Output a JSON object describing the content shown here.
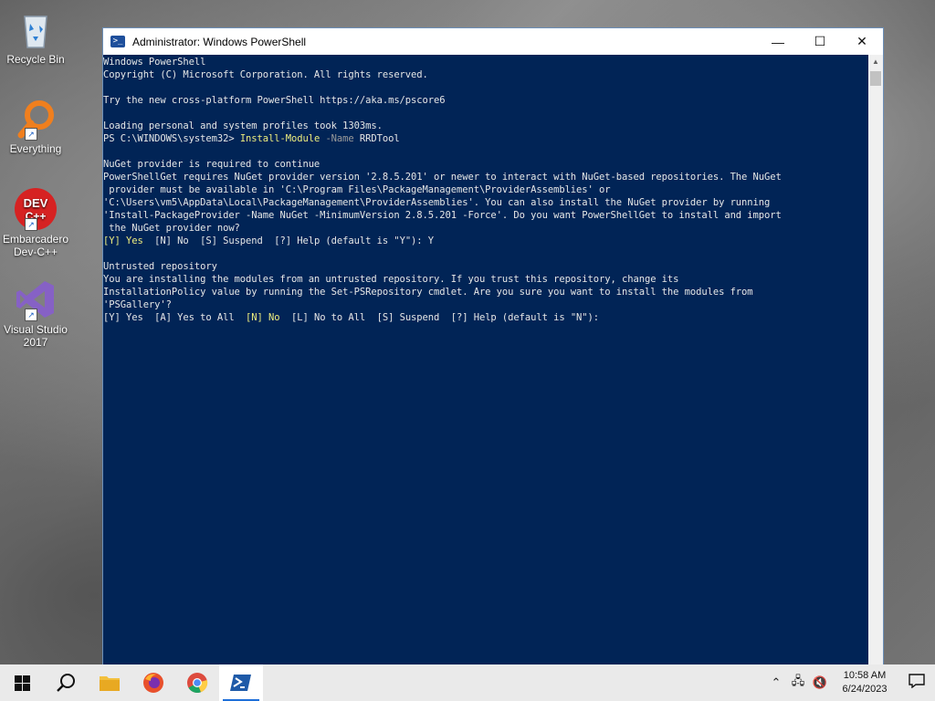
{
  "desktop": {
    "icons": [
      {
        "label": "Recycle Bin"
      },
      {
        "label": "Everything"
      },
      {
        "label": "Embarcadero Dev-C++"
      },
      {
        "label": "Visual Studio 2017"
      }
    ]
  },
  "window": {
    "title": "Administrator: Windows PowerShell",
    "minimize_glyph": "—",
    "maximize_glyph": "☐",
    "close_glyph": "✕"
  },
  "console": {
    "l1": "Windows PowerShell",
    "l2": "Copyright (C) Microsoft Corporation. All rights reserved.",
    "l3": "",
    "l4": "Try the new cross-platform PowerShell https://aka.ms/pscore6",
    "l5": "",
    "l6": "Loading personal and system profiles took 1303ms.",
    "l7_prompt": "PS C:\\WINDOWS\\system32> ",
    "l7_cmd": "Install-Module",
    "l7_param": " -Name",
    "l7_arg": " RRDTool",
    "l8": "",
    "l9": "NuGet provider is required to continue",
    "l10": "PowerShellGet requires NuGet provider version '2.8.5.201' or newer to interact with NuGet-based repositories. The NuGet",
    "l11": " provider must be available in 'C:\\Program Files\\PackageManagement\\ProviderAssemblies' or",
    "l12": "'C:\\Users\\vm5\\AppData\\Local\\PackageManagement\\ProviderAssemblies'. You can also install the NuGet provider by running",
    "l13": "'Install-PackageProvider -Name NuGet -MinimumVersion 2.8.5.201 -Force'. Do you want PowerShellGet to install and import",
    "l14": " the NuGet provider now?",
    "l15_yes": "[Y] Yes",
    "l15_rest": "  [N] No  [S] Suspend  [?] Help (default is \"Y\"): Y",
    "l16": "",
    "l17": "Untrusted repository",
    "l18": "You are installing the modules from an untrusted repository. If you trust this repository, change its",
    "l19": "InstallationPolicy value by running the Set-PSRepository cmdlet. Are you sure you want to install the modules from",
    "l20": "'PSGallery'?",
    "l21_a": "[Y] Yes  [A] Yes to All  ",
    "l21_no": "[N] No",
    "l21_b": "  [L] No to All  [S] Suspend  [?] Help (default is \"N\"):"
  },
  "taskbar": {
    "time": "10:58 AM",
    "date": "6/24/2023"
  },
  "colors": {
    "console_bg": "#012456",
    "highlight_yellow": "#eeed7e",
    "param_gray": "#9a9a9a"
  }
}
